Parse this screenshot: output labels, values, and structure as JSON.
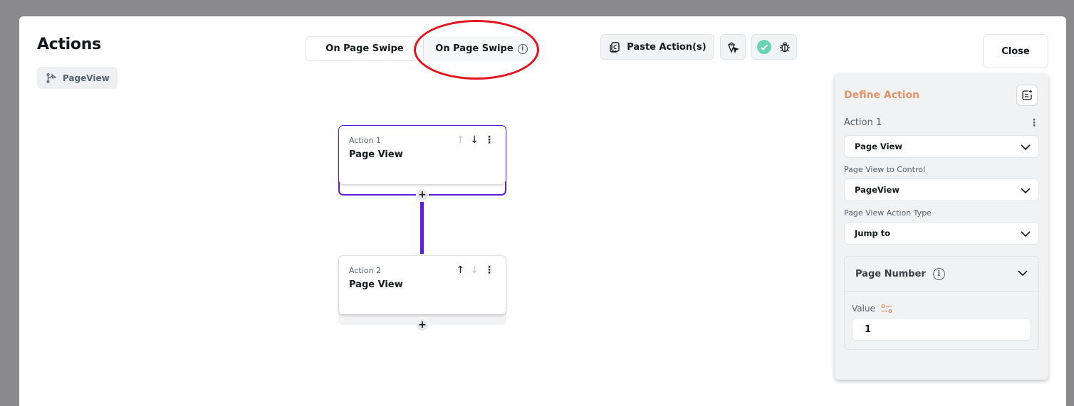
{
  "header": {
    "title": "Actions",
    "widget_chip": "PageView"
  },
  "tabs": [
    {
      "label": "On Page Swipe"
    },
    {
      "label": "On Page Swipe"
    }
  ],
  "toolbar": {
    "paste_label": "Paste Action(s)"
  },
  "close_label": "Close",
  "flow": {
    "actions": [
      {
        "label": "Action 1",
        "name": "Page View",
        "selected": true
      },
      {
        "label": "Action 2",
        "name": "Page View",
        "selected": false
      }
    ]
  },
  "panel": {
    "title": "Define Action",
    "action_name": "Action 1",
    "action_type": "Page View",
    "control_label": "Page View to Control",
    "control_value": "PageView",
    "type_label": "Page View Action Type",
    "type_value": "Jump to",
    "page_number_label": "Page Number",
    "value_label": "Value",
    "value": "1"
  },
  "colors": {
    "accent": "#5b1fe0",
    "define_action": "#e0956b",
    "annotation": "#e0141e",
    "success": "#69d4b0"
  }
}
